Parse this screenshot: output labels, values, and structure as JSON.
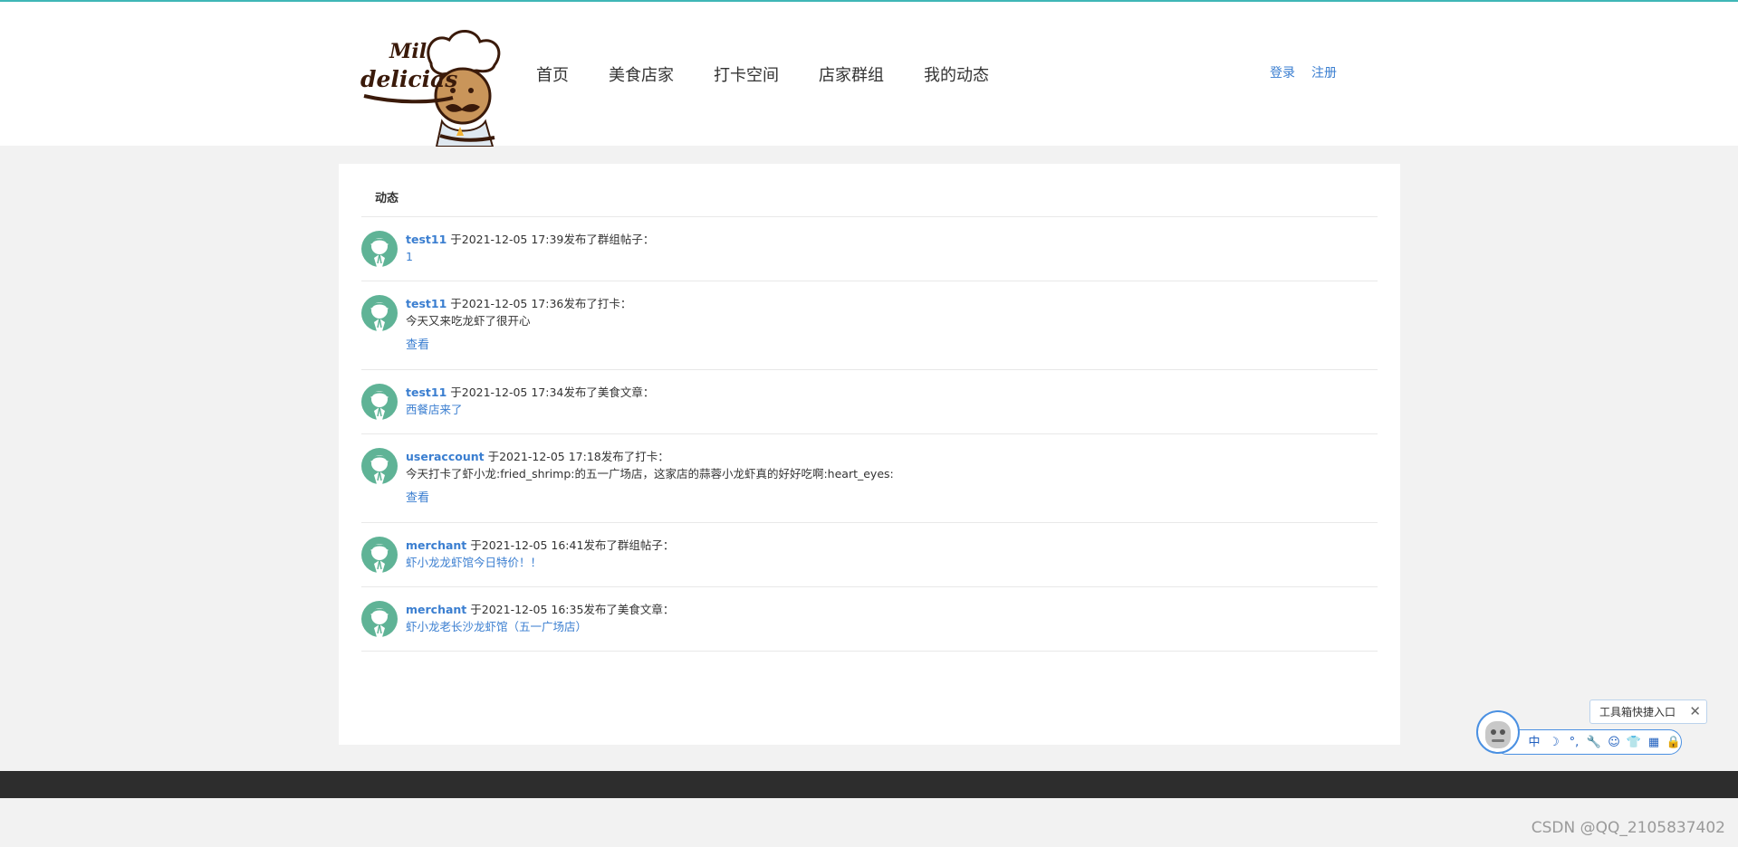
{
  "header": {
    "logo_text": [
      "Mil",
      "delicias"
    ],
    "nav": [
      "首页",
      "美食店家",
      "打卡空间",
      "店家群组",
      "我的动态"
    ],
    "auth": [
      "登录",
      "注册"
    ]
  },
  "feed": {
    "title": "动态",
    "items": [
      {
        "user": "test11",
        "meta": " 于2021-12-05 17:39发布了群组帖子：",
        "content": "1",
        "content_is_link": true,
        "view": ""
      },
      {
        "user": "test11",
        "meta": " 于2021-12-05 17:36发布了打卡：",
        "content": "今天又来吃龙虾了很开心",
        "content_is_link": false,
        "view": "查看"
      },
      {
        "user": "test11",
        "meta": " 于2021-12-05 17:34发布了美食文章：",
        "content": "西餐店来了",
        "content_is_link": true,
        "view": ""
      },
      {
        "user": "useraccount",
        "meta": " 于2021-12-05 17:18发布了打卡：",
        "content": "今天打卡了虾小龙:fried_shrimp:的五一广场店，这家店的蒜蓉小龙虾真的好好吃啊:heart_eyes:",
        "content_is_link": false,
        "view": "查看"
      },
      {
        "user": "merchant",
        "meta": " 于2021-12-05 16:41发布了群组帖子：",
        "content": "虾小龙龙虾馆今日特价！！",
        "content_is_link": true,
        "view": ""
      },
      {
        "user": "merchant",
        "meta": " 于2021-12-05 16:35发布了美食文章：",
        "content": "虾小龙老长沙龙虾馆（五一广场店）",
        "content_is_link": true,
        "view": ""
      }
    ]
  },
  "toolbox": {
    "tip": "工具箱快捷入口",
    "close": "✕",
    "icons": [
      {
        "name": "chinese-input-icon",
        "glyph": "中"
      },
      {
        "name": "moon-icon",
        "glyph": "☽"
      },
      {
        "name": "punctuation-icon",
        "glyph": "°,"
      },
      {
        "name": "wrench-icon",
        "glyph": "🔧"
      },
      {
        "name": "smiley-icon",
        "glyph": "☺"
      },
      {
        "name": "shirt-icon",
        "glyph": "👕"
      },
      {
        "name": "grid-icon",
        "glyph": "▦"
      },
      {
        "name": "lock-icon",
        "glyph": "🔒"
      }
    ]
  },
  "watermark": "CSDN @QQ_2105837402",
  "colors": {
    "link": "#3a7ed0",
    "accent_line": "#3fb6b6",
    "avatar": "#5fb396",
    "footer": "#2d2d2d"
  }
}
